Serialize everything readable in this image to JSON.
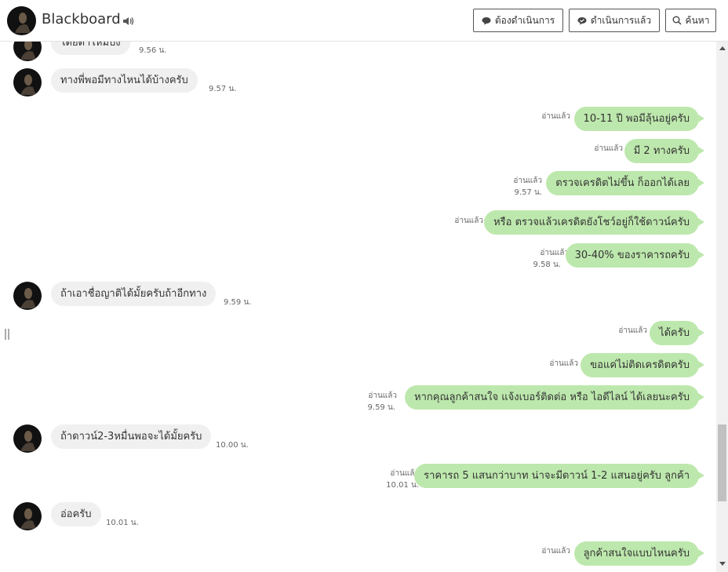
{
  "header": {
    "name": "Blackboard",
    "buttons": {
      "todo": "ต้องดำเนินการ",
      "done": "ดำเนินการแล้ว",
      "search": "ค้นหา"
    }
  },
  "messages": {
    "m0": {
      "text": "ได้ยดาไหมบง",
      "time": "9.56 น."
    },
    "m1": {
      "text": "ทางพี่พอมีทางไหนได้บ้างครับ",
      "time": "9.57 น."
    },
    "m2": {
      "text": "10-11 ปี พอมีลุ้นอยู่ครับ",
      "read": "อ่านแล้ว"
    },
    "m3": {
      "text": "มี 2 ทางครับ",
      "read": "อ่านแล้ว"
    },
    "m4": {
      "text": "ตรวจเครดิตไม่ขึ้น ก็ออกได้เลย",
      "read": "อ่านแล้ว",
      "time": "9.57 น."
    },
    "m5": {
      "text": "หรือ ตรวจแล้วเครดิตยังโชว์อยู่ก็ใช้ดาวน์ครับ",
      "read": "อ่านแล้ว"
    },
    "m6": {
      "text": "30-40% ของราคารถครับ",
      "read": "อ่านแล้ว",
      "time": "9.58 น."
    },
    "m7": {
      "text": "ถ้าเอาชื่อญาติได้มั้ยครับถ้าอีกทาง",
      "time": "9.59 น."
    },
    "m8": {
      "text": "ได้ครับ",
      "read": "อ่านแล้ว"
    },
    "m9": {
      "text": "ขอแค่ไม่ติดเครดิตครับ",
      "read": "อ่านแล้ว"
    },
    "m10": {
      "text": "หากคุณลูกค้าสนใจ แจ้งเบอร์ติดต่อ หรือ ไอดีไลน์ ได้เลยนะครับ",
      "read": "อ่านแล้ว",
      "time": "9.59 น."
    },
    "m11": {
      "text": "ถ้าดาวน์2-3หมื่นพอจะได้มั้ยครับ",
      "time": "10.00 น."
    },
    "m12": {
      "text": "ราคารถ 5 แสนกว่าบาท น่าจะมีดาวน์ 1-2 แสนอยู่ครับ ลูกค้า",
      "read": "อ่านแล้ว",
      "time": "10.01 น."
    },
    "m13": {
      "text": "อ่อครับ",
      "time": "10.01 น."
    },
    "m14": {
      "text": "ลูกค้าสนใจแบบไหนครับ",
      "read": "อ่านแล้ว"
    }
  },
  "colors": {
    "outgoing_bubble": "#bde8ad",
    "incoming_bubble": "#f0f0f0"
  },
  "icons": {
    "speaker": "speaker-icon",
    "todo": "chat-bubble-icon",
    "done": "check-bubble-icon",
    "search": "search-icon"
  }
}
